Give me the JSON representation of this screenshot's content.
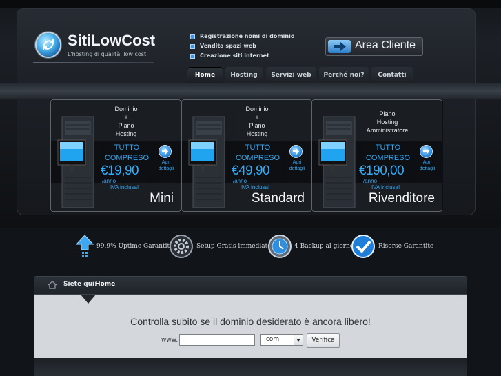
{
  "brand": {
    "name": "SitiLowCost",
    "tagline": "L'hosting di qualità, low cost"
  },
  "features": [
    "Registrazione nomi di dominio",
    "Vendita spazi web",
    "Creazione siti internet"
  ],
  "area_cliente": {
    "label": "Area Cliente"
  },
  "nav": {
    "tabs": [
      "Home",
      "Hosting",
      "Servizi web",
      "Perché noi?",
      "Contatti"
    ],
    "active": "Home"
  },
  "plans": [
    {
      "desc": [
        "Dominio",
        "+",
        "Piano",
        "Hosting"
      ],
      "tutto": [
        "TUTTO",
        "COMPRESO"
      ],
      "price": "€19,90",
      "anno": "/anno",
      "iva": "IVA inclusa!",
      "name": "Mini",
      "link": [
        "Apri",
        "dettagli"
      ]
    },
    {
      "desc": [
        "Dominio",
        "+",
        "Piano",
        "Hosting"
      ],
      "tutto": [
        "TUTTO",
        "COMPRESO"
      ],
      "price": "€49,90",
      "anno": "/anno",
      "iva": "IVA inclusa!",
      "name": "Standard",
      "link": [
        "Apri",
        "dettagli"
      ]
    },
    {
      "desc": [
        "Piano",
        "Hosting",
        "Amministratore"
      ],
      "tutto": [
        "TUTTO",
        "COMPRESO"
      ],
      "price": "€190,00",
      "anno": "/anno",
      "iva": "IVA inclusa!",
      "name": "Rivenditore",
      "link": [
        "Apri",
        "dettagli"
      ]
    }
  ],
  "guarantees": [
    {
      "icon": "upload-arrow-icon",
      "text": "99,9% Uptime Garantito"
    },
    {
      "icon": "gear-icon",
      "text": "Setup Gratis immediato"
    },
    {
      "icon": "backup-clock-icon",
      "text": "4 Backup al giorno"
    },
    {
      "icon": "checkmark-icon",
      "text": "Risorse Garantite"
    }
  ],
  "breadcrumb": {
    "label": "Siete qui:",
    "current": "Home"
  },
  "domain_check": {
    "title": "Controlla subito se il dominio desiderato è ancora libero!",
    "prefix": "www.",
    "input_value": "",
    "tld_selected": ".com",
    "button": "Verifica"
  },
  "colors": {
    "accent": "#36a6f1",
    "background": "#0f1216",
    "content_bg": "#d4d8dc"
  }
}
